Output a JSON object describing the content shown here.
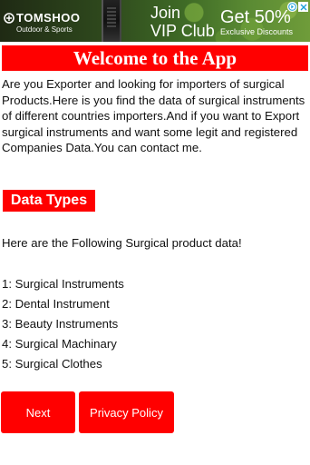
{
  "ad": {
    "brand_name": "TOMSHOO",
    "brand_tagline": "Outdoor & Sports",
    "headline_line1": "Join",
    "headline_line2": "VIP Club",
    "promo_big": "Get 50%",
    "promo_small": "Exclusive Discounts",
    "adchoices_icon": "adchoices-icon",
    "close_icon": "close-icon"
  },
  "header": {
    "title": "Welcome to the App"
  },
  "intro": {
    "text": "Are you Exporter and looking for importers of surgical Products.Here is you find the data of surgical instruments of different countries importers.And if you want to Export surgical instruments and want some legit and registered Companies Data.You can contact me."
  },
  "section": {
    "label": "Data Types",
    "subtext": "Here are the Following Surgical product data!"
  },
  "products": [
    "1: Surgical Instruments",
    "2: Dental Instrument",
    "3: Beauty Instruments",
    "4: Surgical Machinary",
    "5: Surgical Clothes"
  ],
  "buttons": {
    "next": "Next",
    "privacy": "Privacy Policy"
  },
  "colors": {
    "accent": "#ff0000",
    "text": "#111111",
    "background": "#ffffff"
  }
}
